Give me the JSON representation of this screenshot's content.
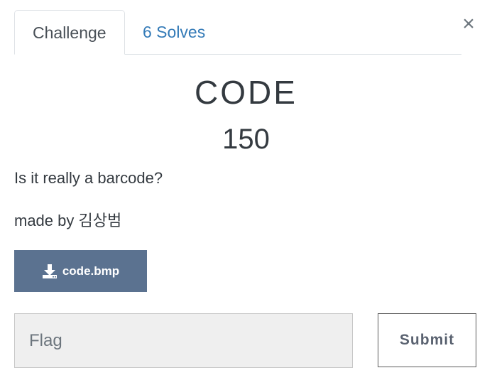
{
  "tabs": [
    {
      "label": "Challenge",
      "active": true
    },
    {
      "label": "6 Solves",
      "active": false
    }
  ],
  "close_label": "×",
  "challenge": {
    "name": "CODE",
    "points": "150",
    "description": [
      "Is it really a barcode?",
      "made by 김상범"
    ]
  },
  "file": {
    "label": "code.bmp",
    "icon": "download-icon"
  },
  "flag_form": {
    "placeholder": "Flag",
    "value": "",
    "submit_label": "Submit"
  },
  "colors": {
    "tab_link": "#337ab7",
    "file_button_bg": "#5b7290",
    "input_bg": "#efefef",
    "text": "#343a40"
  }
}
